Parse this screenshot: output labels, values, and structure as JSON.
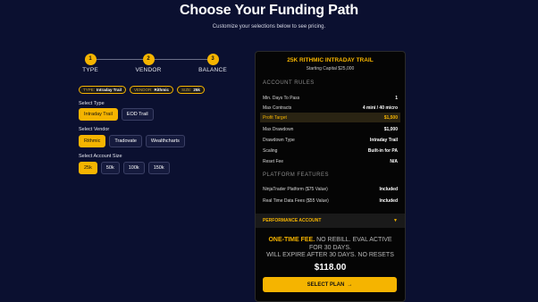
{
  "header": {
    "title": "Choose Your Funding Path",
    "subtitle": "Customize your selections below to see pricing."
  },
  "steps": [
    {
      "num": "1",
      "label": "TYPE"
    },
    {
      "num": "2",
      "label": "VENDOR"
    },
    {
      "num": "3",
      "label": "BALANCE"
    }
  ],
  "chips": [
    {
      "key": "TYPE:",
      "value": "Intraday Trail"
    },
    {
      "key": "VENDOR:",
      "value": "Rithmic"
    },
    {
      "key": "SIZE:",
      "value": "25k"
    }
  ],
  "type_section": {
    "label": "Select Type",
    "options": [
      "Intraday Trail",
      "EOD Trail"
    ],
    "selected": "Intraday Trail"
  },
  "vendor_section": {
    "label": "Select Vendor",
    "options": [
      "Rithmic",
      "Tradovate",
      "Wealthcharts"
    ],
    "selected": "Rithmic"
  },
  "size_section": {
    "label": "Select Account Size",
    "options": [
      "25k",
      "50k",
      "100k",
      "150k"
    ],
    "selected": "25k"
  },
  "panel": {
    "title": "25K RITHMIC INTRADAY TRAIL",
    "starting_capital": "Starting Capital $25,000",
    "rules_heading": "ACCOUNT RULES",
    "rules": [
      {
        "k": "Min. Days To Pass",
        "v": "1"
      },
      {
        "k": "Max Contracts",
        "v": "4 mini / 40 micro"
      },
      {
        "k": "Profit Target",
        "v": "$1,500"
      },
      {
        "k": "Max Drawdown",
        "v": "$1,000"
      },
      {
        "k": "Drawdown Type",
        "v": "Intraday Trail"
      },
      {
        "k": "Scaling",
        "v": "Built-in for PA"
      },
      {
        "k": "Reset Fee",
        "v": "N/A"
      }
    ],
    "features_heading": "PLATFORM FEATURES",
    "features": [
      {
        "k": "NinjaTrader Platform ($75 Value)",
        "v": "Included"
      },
      {
        "k": "Real Time Data Fees ($55 Value)",
        "v": "Included"
      }
    ],
    "performance_label": "PERFORMANCE ACCOUNT",
    "fee_highlight": "ONE-TIME FEE.",
    "fee_line1_rest": " NO REBILL. EVAL ACTIVE",
    "fee_line2": "FOR 30 DAYS.",
    "fee_line3": "WILL EXPIRE AFTER 30 DAYS. NO RESETS",
    "price": "$118.00",
    "cta": "SELECT PLAN"
  }
}
